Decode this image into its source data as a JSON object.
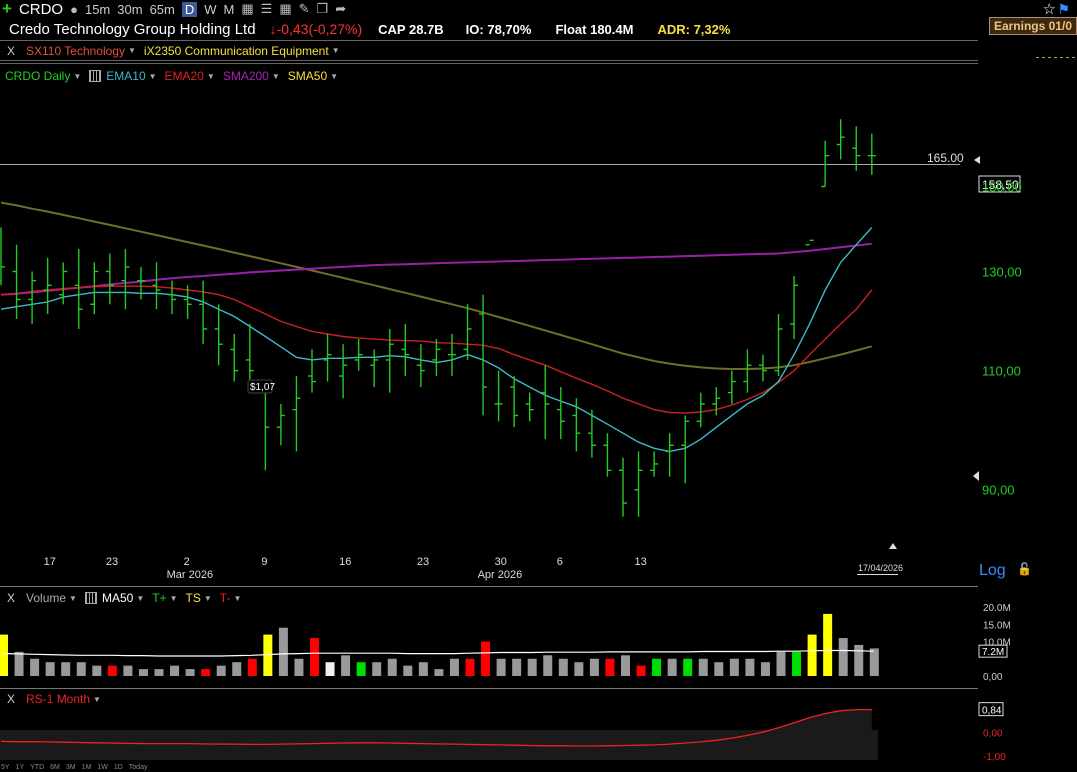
{
  "toolbar": {
    "symbol": "CRDO",
    "tf_15m": "15m",
    "tf_30m": "30m",
    "tf_65m": "65m",
    "tf_d": "D",
    "tf_w": "W",
    "tf_m": "M"
  },
  "header": {
    "company": "Credo Technology Group Holding Ltd",
    "change": "-0,43(-0,27%)",
    "cap": "CAP 28.7B",
    "io": "IO: 78,70%",
    "float": "Float 180.4M",
    "adr": "ADR: 7,32%",
    "earnings": "Earnings 01/0"
  },
  "industry": {
    "x": "X",
    "sector": "SX110 Technology",
    "group": "iX2350 Communication Equipment"
  },
  "ma_bar": {
    "label": "CRDO Daily",
    "ema10": "EMA10",
    "ema20": "EMA20",
    "sma200": "SMA200",
    "sma50": "SMA50"
  },
  "colors": {
    "up": "#22cc22",
    "down": "#22cc22",
    "ema10": "#3fb8c8",
    "ema20": "#cc2020",
    "sma200": "#9a20a8",
    "sma50": "#6e6e2a"
  },
  "price_annotations": {
    "hline": "165.00",
    "last": "158,50",
    "dividend": "$1,07",
    "date_badge": "17/04/2026",
    "scale": "Log"
  },
  "volume_panel": {
    "x": "X",
    "label": "Volume",
    "ma": "MA50",
    "tplus": "T+",
    "ts": "TS",
    "tminus": "T-",
    "ticks": [
      "20.0M",
      "15.0M",
      "10.0M",
      "7.2M",
      "0,00"
    ]
  },
  "rs_panel": {
    "x": "X",
    "label": "RS-1 Month",
    "ticks": [
      "0,84",
      "0,00",
      "-1,00"
    ]
  },
  "range_buttons": [
    "5Y",
    "1Y",
    "YTD",
    "6M",
    "3M",
    "1M",
    "1W",
    "1D",
    "Today"
  ],
  "chart_data": {
    "type": "bar",
    "title": "CRDO Daily",
    "y_scale": "log",
    "ylim": [
      82,
      175
    ],
    "y_ticks": [
      90,
      110,
      130,
      150
    ],
    "x_tick_labels": [
      "17",
      "23",
      "2",
      "9",
      "16",
      "23",
      "30",
      "6",
      "13"
    ],
    "x_tick_index": [
      3,
      7,
      12,
      17,
      22,
      27,
      32,
      36,
      41
    ],
    "x_month_labels": [
      {
        "text": "Mar 2026",
        "index": 12
      },
      {
        "text": "Apr 2026",
        "index": 32
      }
    ],
    "ohlc": [
      [
        128,
        140,
        127,
        131
      ],
      [
        130,
        136,
        120,
        124
      ],
      [
        124,
        130,
        119,
        128
      ],
      [
        126,
        133,
        121,
        127
      ],
      [
        125,
        132,
        123,
        130
      ],
      [
        127,
        135,
        118,
        122
      ],
      [
        123,
        132,
        121,
        130
      ],
      [
        130,
        134,
        123,
        127
      ],
      [
        128,
        135,
        122,
        131
      ],
      [
        128,
        131,
        124,
        128
      ],
      [
        127,
        132,
        122,
        126
      ],
      [
        125,
        128,
        121,
        124
      ],
      [
        124,
        127,
        120,
        123
      ],
      [
        123,
        128,
        115,
        118
      ],
      [
        118,
        123,
        111,
        115
      ],
      [
        114,
        117,
        108,
        110
      ],
      [
        112,
        119,
        106,
        110
      ],
      [
        107,
        108,
        93,
        100
      ],
      [
        100,
        104,
        97,
        102
      ],
      [
        103,
        109,
        96,
        105
      ],
      [
        109,
        114,
        106,
        108
      ],
      [
        112,
        117,
        108,
        113
      ],
      [
        109,
        115,
        105,
        111
      ],
      [
        112,
        116,
        110,
        113
      ],
      [
        111,
        114,
        107,
        112
      ],
      [
        112,
        118,
        106,
        115
      ],
      [
        114,
        119,
        109,
        113
      ],
      [
        111,
        115,
        107,
        110
      ],
      [
        112,
        116,
        109,
        114
      ],
      [
        113,
        117,
        109,
        113
      ],
      [
        114,
        123,
        112,
        118
      ],
      [
        121,
        125,
        102,
        107
      ],
      [
        104,
        110,
        101,
        104
      ],
      [
        107,
        109,
        100,
        102
      ],
      [
        104,
        106,
        101,
        103
      ],
      [
        106,
        111,
        98,
        104
      ],
      [
        103,
        107,
        98,
        101
      ],
      [
        102,
        105,
        96,
        99
      ],
      [
        99,
        103,
        95,
        97
      ],
      [
        97,
        99,
        92,
        93
      ],
      [
        93,
        95,
        86,
        88
      ],
      [
        90,
        96,
        86,
        93
      ],
      [
        93,
        96,
        92,
        94
      ],
      [
        96,
        99,
        92,
        97
      ],
      [
        97,
        102,
        91,
        101
      ],
      [
        101,
        106,
        100,
        104
      ],
      [
        104,
        107,
        102,
        105
      ],
      [
        106,
        110,
        104,
        108
      ],
      [
        108,
        114,
        106,
        111
      ],
      [
        111,
        113,
        108,
        110
      ],
      [
        110,
        121,
        109,
        118
      ],
      [
        119,
        129,
        116,
        127
      ],
      [
        136,
        138,
        138,
        137
      ],
      [
        150,
        162,
        150,
        158
      ],
      [
        161,
        168,
        157,
        163
      ],
      [
        160,
        166,
        154,
        158
      ],
      [
        158,
        164,
        153,
        158
      ]
    ],
    "ema10": [
      122,
      122.5,
      123,
      123.5,
      124.5,
      125,
      125.5,
      125.5,
      125.5,
      125.3,
      125.3,
      125.0,
      124.5,
      123.5,
      122.0,
      120.5,
      118.5,
      116.5,
      114.5,
      112.5,
      112.0,
      112.3,
      112.3,
      112.5,
      112.5,
      112.8,
      112.6,
      112.0,
      111.5,
      112.0,
      113.0,
      112.0,
      110.5,
      108.5,
      107.0,
      105.5,
      104.5,
      103.5,
      102.0,
      100.5,
      99.0,
      97.5,
      96.5,
      96.0,
      96.5,
      98.0,
      100.0,
      102.0,
      104.0,
      105.5,
      108.0,
      113.0,
      119.0,
      126.0,
      132.0,
      136.0,
      140.0
    ],
    "ema20": [
      125,
      125.3,
      125.7,
      126.0,
      126.3,
      126.5,
      126.7,
      126.8,
      126.8,
      126.8,
      126.7,
      126.4,
      126.0,
      125.6,
      125.0,
      124.0,
      122.5,
      121.0,
      119.5,
      118.5,
      117.5,
      117.0,
      116.5,
      116.2,
      116.0,
      115.8,
      115.7,
      115.6,
      115.3,
      115.2,
      115.0,
      114.8,
      114.2,
      113.0,
      112.0,
      111.0,
      109.8,
      108.6,
      107.5,
      106.3,
      105.0,
      104.0,
      103.0,
      102.5,
      102.4,
      102.6,
      103.0,
      103.8,
      104.8,
      106.0,
      107.8,
      110.0,
      113.0,
      116.0,
      119.0,
      122.0,
      126.0
    ],
    "sma200": [
      125.0,
      125.2,
      125.5,
      125.8,
      126.2,
      126.5,
      126.8,
      127.2,
      127.5,
      127.8,
      128.2,
      128.5,
      128.8,
      129.0,
      129.3,
      129.5,
      129.8,
      130.0,
      130.2,
      130.4,
      130.6,
      130.8,
      131.0,
      131.2,
      131.4,
      131.5,
      131.6,
      131.7,
      131.8,
      131.9,
      132.0,
      132.1,
      132.2,
      132.3,
      132.4,
      132.5,
      132.6,
      132.7,
      132.8,
      132.9,
      133.0,
      133.1,
      133.2,
      133.3,
      133.4,
      133.5,
      133.6,
      133.7,
      133.8,
      133.9,
      134.0,
      134.3,
      134.6,
      135.0,
      135.4,
      135.8,
      136.2
    ],
    "sma50": [
      146.0,
      145.3,
      144.5,
      143.8,
      143.0,
      142.2,
      141.4,
      140.6,
      139.8,
      139.0,
      138.2,
      137.4,
      136.6,
      135.8,
      135.0,
      134.2,
      133.4,
      132.6,
      131.8,
      131.0,
      130.2,
      129.4,
      128.6,
      127.8,
      127.0,
      126.2,
      125.4,
      124.6,
      123.8,
      123.0,
      122.2,
      121.3,
      120.4,
      119.5,
      118.6,
      117.7,
      116.8,
      115.9,
      115.0,
      114.1,
      113.2,
      112.5,
      111.8,
      111.3,
      110.9,
      110.6,
      110.4,
      110.3,
      110.3,
      110.4,
      110.6,
      111.0,
      111.6,
      112.3,
      113.0,
      113.8,
      114.6
    ],
    "volume": [
      12,
      7,
      5,
      4,
      4,
      4,
      3,
      3,
      3,
      2,
      2,
      3,
      2,
      2,
      3,
      4,
      5,
      12,
      14,
      5,
      11,
      4,
      6,
      4,
      4,
      5,
      3,
      4,
      2,
      5,
      5,
      10,
      5,
      5,
      5,
      6,
      5,
      4,
      5,
      5,
      6,
      3,
      5,
      5,
      5,
      5,
      4,
      5,
      5,
      4,
      7,
      7,
      12,
      18,
      11,
      9,
      8
    ],
    "volume_ma50": [
      6.5,
      6.4,
      6.3,
      6.2,
      6.1,
      6.0,
      6.0,
      6.0,
      5.9,
      5.9,
      5.8,
      5.8,
      5.8,
      5.8,
      5.8,
      5.9,
      6.0,
      6.2,
      6.4,
      6.5,
      6.6,
      6.6,
      6.6,
      6.6,
      6.6,
      6.6,
      6.5,
      6.5,
      6.5,
      6.5,
      6.6,
      6.7,
      6.8,
      6.8,
      6.8,
      6.9,
      6.9,
      6.9,
      6.9,
      7.0,
      7.0,
      7.0,
      7.0,
      7.0,
      7.0,
      7.1,
      7.1,
      7.1,
      7.1,
      7.1,
      7.2,
      7.2,
      7.3,
      7.4,
      7.4,
      7.3,
      7.2
    ],
    "volume_colors": [
      "#ff0",
      "#999",
      "#999",
      "#999",
      "#999",
      "#999",
      "#999",
      "#f00",
      "#999",
      "#999",
      "#999",
      "#999",
      "#999",
      "#f00",
      "#999",
      "#999",
      "#f00",
      "#ff0",
      "#999",
      "#999",
      "#f00",
      "#f0f0f0",
      "#999",
      "#0d0",
      "#999",
      "#999",
      "#999",
      "#999",
      "#999",
      "#999",
      "#f00",
      "#f00",
      "#999",
      "#999",
      "#999",
      "#999",
      "#999",
      "#999",
      "#999",
      "#f00",
      "#999",
      "#f00",
      "#0d0",
      "#999",
      "#0d0",
      "#999",
      "#999",
      "#999",
      "#999",
      "#999",
      "#999",
      "#0d0",
      "#ff0",
      "#ff0",
      "#999",
      "#999",
      "#999"
    ],
    "rs": [
      -0.32,
      -0.33,
      -0.33,
      -0.34,
      -0.35,
      -0.36,
      -0.37,
      -0.38,
      -0.39,
      -0.4,
      -0.4,
      -0.4,
      -0.4,
      -0.41,
      -0.42,
      -0.42,
      -0.43,
      -0.43,
      -0.42,
      -0.41,
      -0.4,
      -0.39,
      -0.38,
      -0.37,
      -0.37,
      -0.38,
      -0.39,
      -0.4,
      -0.41,
      -0.42,
      -0.43,
      -0.44,
      -0.45,
      -0.46,
      -0.47,
      -0.48,
      -0.48,
      -0.49,
      -0.49,
      -0.48,
      -0.47,
      -0.46,
      -0.45,
      -0.42,
      -0.38,
      -0.34,
      -0.28,
      -0.2,
      -0.1,
      0.02,
      0.18,
      0.36,
      0.55,
      0.7,
      0.8,
      0.84,
      0.84
    ]
  }
}
